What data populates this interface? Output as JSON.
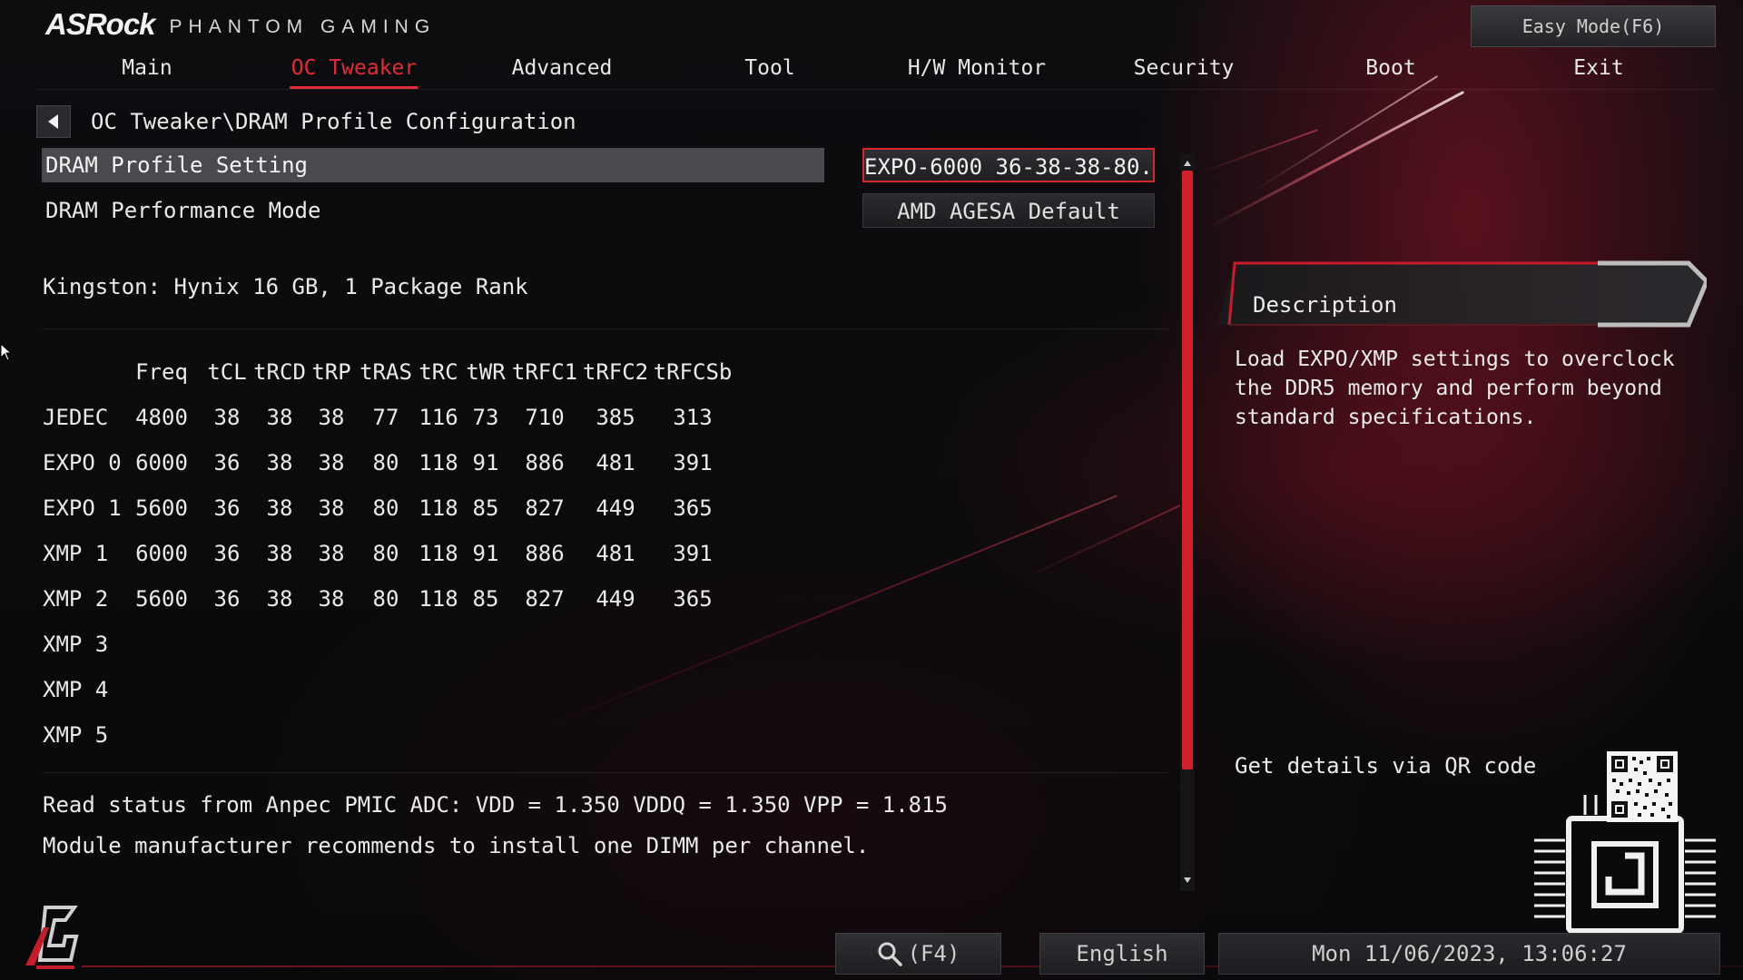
{
  "header": {
    "brand": "ASRock",
    "brand_sub": "PHANTOM GAMING",
    "easy_mode": "Easy Mode(F6)"
  },
  "nav": {
    "tabs": [
      {
        "label": "Main"
      },
      {
        "label": "OC Tweaker",
        "active": true
      },
      {
        "label": "Advanced"
      },
      {
        "label": "Tool"
      },
      {
        "label": "H/W Monitor"
      },
      {
        "label": "Security"
      },
      {
        "label": "Boot"
      },
      {
        "label": "Exit"
      }
    ]
  },
  "breadcrumb": "OC Tweaker\\DRAM Profile Configuration",
  "settings": {
    "profile": {
      "label": "DRAM Profile Setting",
      "value": "EXPO-6000 36-38-38-80..."
    },
    "performance": {
      "label": "DRAM Performance Mode",
      "value": "AMD AGESA Default"
    }
  },
  "module_info": "Kingston: Hynix 16 GB, 1 Package Rank",
  "timings": {
    "headers": [
      "Freq",
      "tCL",
      "tRCD",
      "tRP",
      "tRAS",
      "tRC",
      "tWR",
      "tRFC1",
      "tRFC2",
      "tRFCSb"
    ],
    "rows": [
      {
        "name": "JEDEC",
        "values": [
          "4800",
          "38",
          "38",
          "38",
          "77",
          "116",
          "73",
          "710",
          "385",
          "313"
        ]
      },
      {
        "name": "EXPO 0",
        "values": [
          "6000",
          "36",
          "38",
          "38",
          "80",
          "118",
          "91",
          "886",
          "481",
          "391"
        ]
      },
      {
        "name": "EXPO 1",
        "values": [
          "5600",
          "36",
          "38",
          "38",
          "80",
          "118",
          "85",
          "827",
          "449",
          "365"
        ]
      },
      {
        "name": "XMP 1",
        "values": [
          "6000",
          "36",
          "38",
          "38",
          "80",
          "118",
          "91",
          "886",
          "481",
          "391"
        ]
      },
      {
        "name": "XMP 2",
        "values": [
          "5600",
          "36",
          "38",
          "38",
          "80",
          "118",
          "85",
          "827",
          "449",
          "365"
        ]
      },
      {
        "name": "XMP 3",
        "values": []
      },
      {
        "name": "XMP 4",
        "values": []
      },
      {
        "name": "XMP 5",
        "values": []
      }
    ]
  },
  "status": {
    "pmic": "Read status from Anpec PMIC ADC: VDD = 1.350 VDDQ = 1.350 VPP = 1.815",
    "recommendation": "Module manufacturer recommends to install one DIMM per channel."
  },
  "description": {
    "title": "Description",
    "text": "Load EXPO/XMP settings to overclock the DDR5 memory and perform beyond standard specifications.",
    "qr_label": "Get details via QR code"
  },
  "footer": {
    "search_label": "(F4)",
    "language": "English",
    "datetime": "Mon 11/06/2023, 13:06:27"
  },
  "colors": {
    "accent": "#e22b3a",
    "highlight_row": "#4a4a4e",
    "background": "#0a0a0c"
  },
  "icons": [
    "back-arrow-icon",
    "search-icon",
    "qr-code-icon",
    "chip-icon",
    "phantom-gaming-logo-icon",
    "mouse-cursor-icon",
    "scroll-up-arrow-icon",
    "scroll-down-arrow-icon"
  ]
}
